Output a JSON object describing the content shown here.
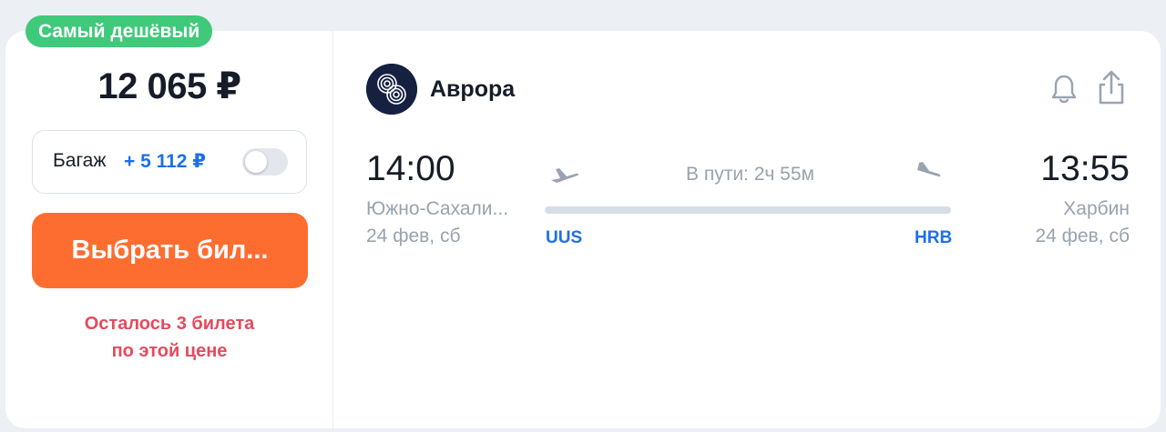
{
  "badge": "Самый дешёвый",
  "price": "12 065 ₽",
  "baggage": {
    "label": "Багаж",
    "price": "+ 5 112 ₽",
    "enabled": false
  },
  "buy_button": "Выбрать бил...",
  "notice": {
    "line1": "Осталось 3 билета",
    "line2": "по этой цене"
  },
  "airline": {
    "name": "Аврора",
    "logo_icon": "aurora-logo-icon"
  },
  "actions": {
    "bell_icon": "bell-icon",
    "share_icon": "share-icon"
  },
  "flight": {
    "departure": {
      "time": "14:00",
      "city": "Южно-Сахали...",
      "date": "24 фев, сб",
      "code": "UUS"
    },
    "arrival": {
      "time": "13:55",
      "city": "Харбин",
      "date": "24 фев, сб",
      "code": "HRB"
    },
    "duration": "В пути: 2ч 55м"
  },
  "colors": {
    "badge": "#3fc97a",
    "buy_button": "#fe6d30",
    "notice": "#e34b5d",
    "accent_blue": "#1e6fe8",
    "muted": "#98a2af"
  }
}
